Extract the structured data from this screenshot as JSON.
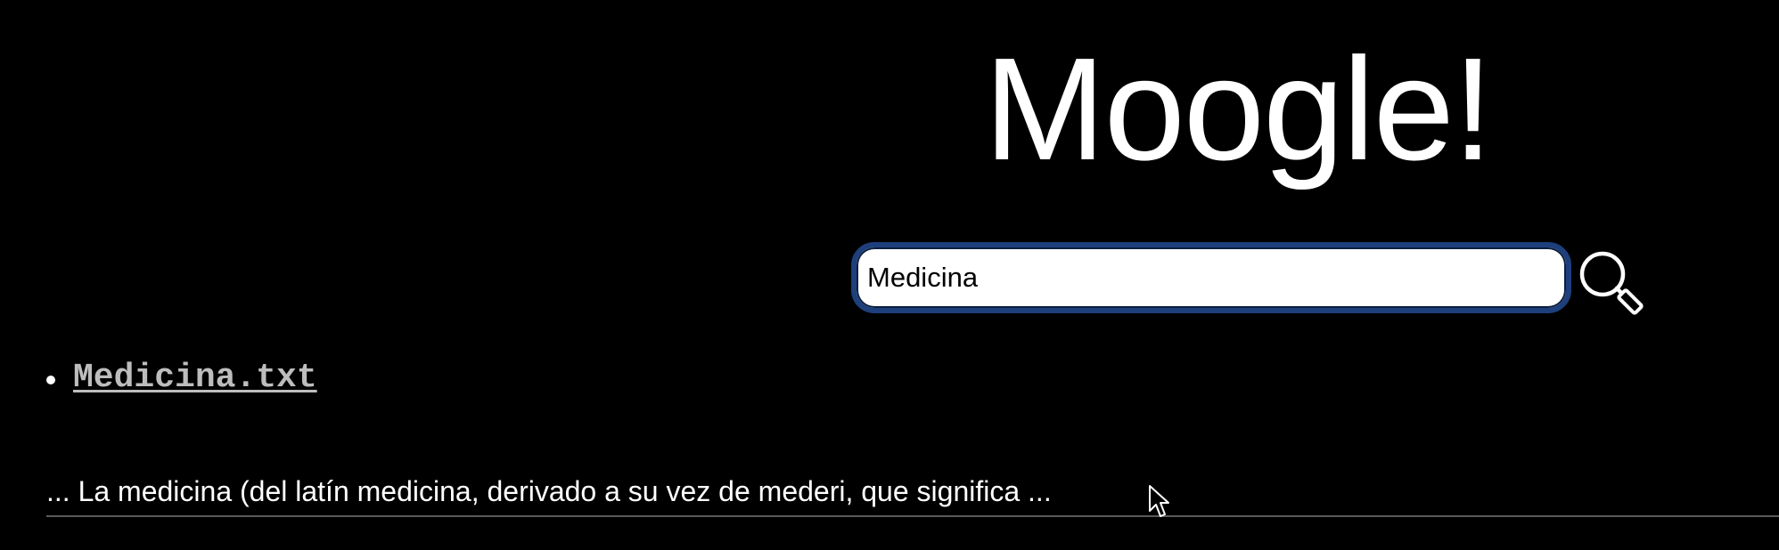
{
  "header": {
    "logo_text": "Moogle!"
  },
  "search": {
    "value": "Medicina",
    "button_icon": "magnifier-icon"
  },
  "results": [
    {
      "title": "Medicina.txt",
      "snippet": "... La medicina (del latín medicina, derivado a su vez de mederi, que significa ..."
    }
  ],
  "colors": {
    "background": "#000000",
    "text": "#ffffff",
    "link": "#bdbdbd",
    "input_border": "#1d3f7c",
    "divider": "#5a5a5a"
  }
}
